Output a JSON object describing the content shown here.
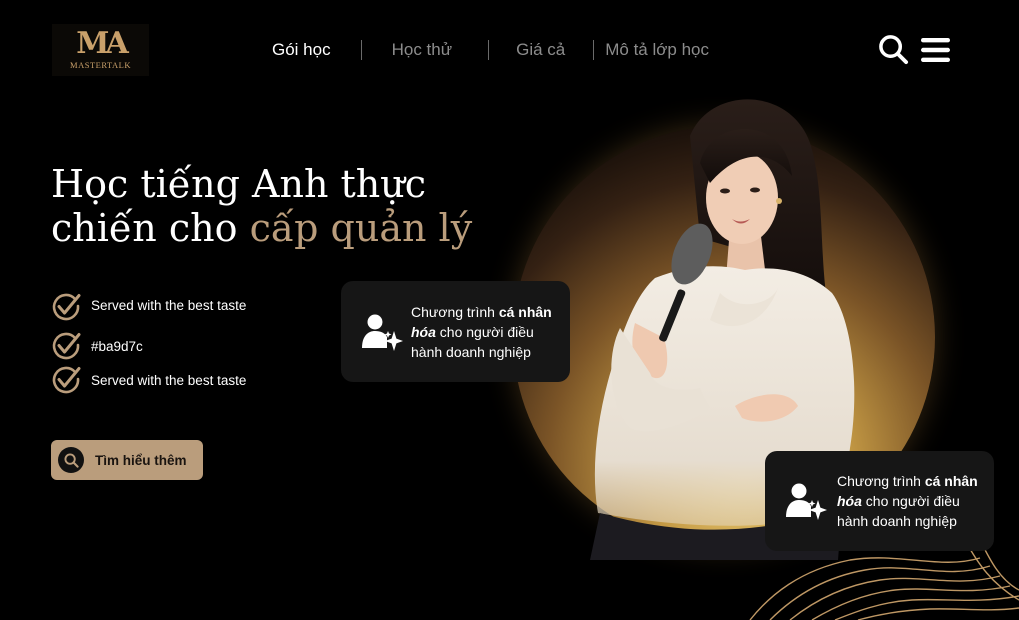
{
  "brand": {
    "logo_mark": "MA",
    "logo_text": "MASTERTALK"
  },
  "nav": {
    "items": [
      {
        "label": "Gói học",
        "active": true
      },
      {
        "label": "Học thử",
        "active": false
      },
      {
        "label": "Giá cả",
        "active": false
      },
      {
        "label": "Mô tả lớp học",
        "active": false
      }
    ]
  },
  "header_icons": [
    "search-icon",
    "menu-icon"
  ],
  "hero": {
    "title_line1": "Học tiếng Anh thực",
    "title_line2_prefix": "chiến cho ",
    "title_line2_accent": "cấp quản lý"
  },
  "features": [
    "Served with the best taste",
    "#ba9d7c",
    "Served with the best taste"
  ],
  "cta": {
    "label": "Tìm hiểu thêm",
    "icon": "search-icon"
  },
  "info_cards": [
    {
      "prefix": "Chương trình ",
      "bold": "cá nhân",
      "bold_italic": "hóa",
      "rest": " cho người điều hành doanh nghiệp",
      "icon": "user-sparkle-icon"
    },
    {
      "prefix": "Chương trình ",
      "bold": "cá nhân",
      "bold_italic": "hóa",
      "rest": " cho người điều hành doanh nghiệp",
      "icon": "user-sparkle-icon"
    }
  ],
  "colors": {
    "accent": "#ba9d7c",
    "background": "#000000",
    "card": "#161616",
    "nav_inactive": "#8c8c8c"
  }
}
